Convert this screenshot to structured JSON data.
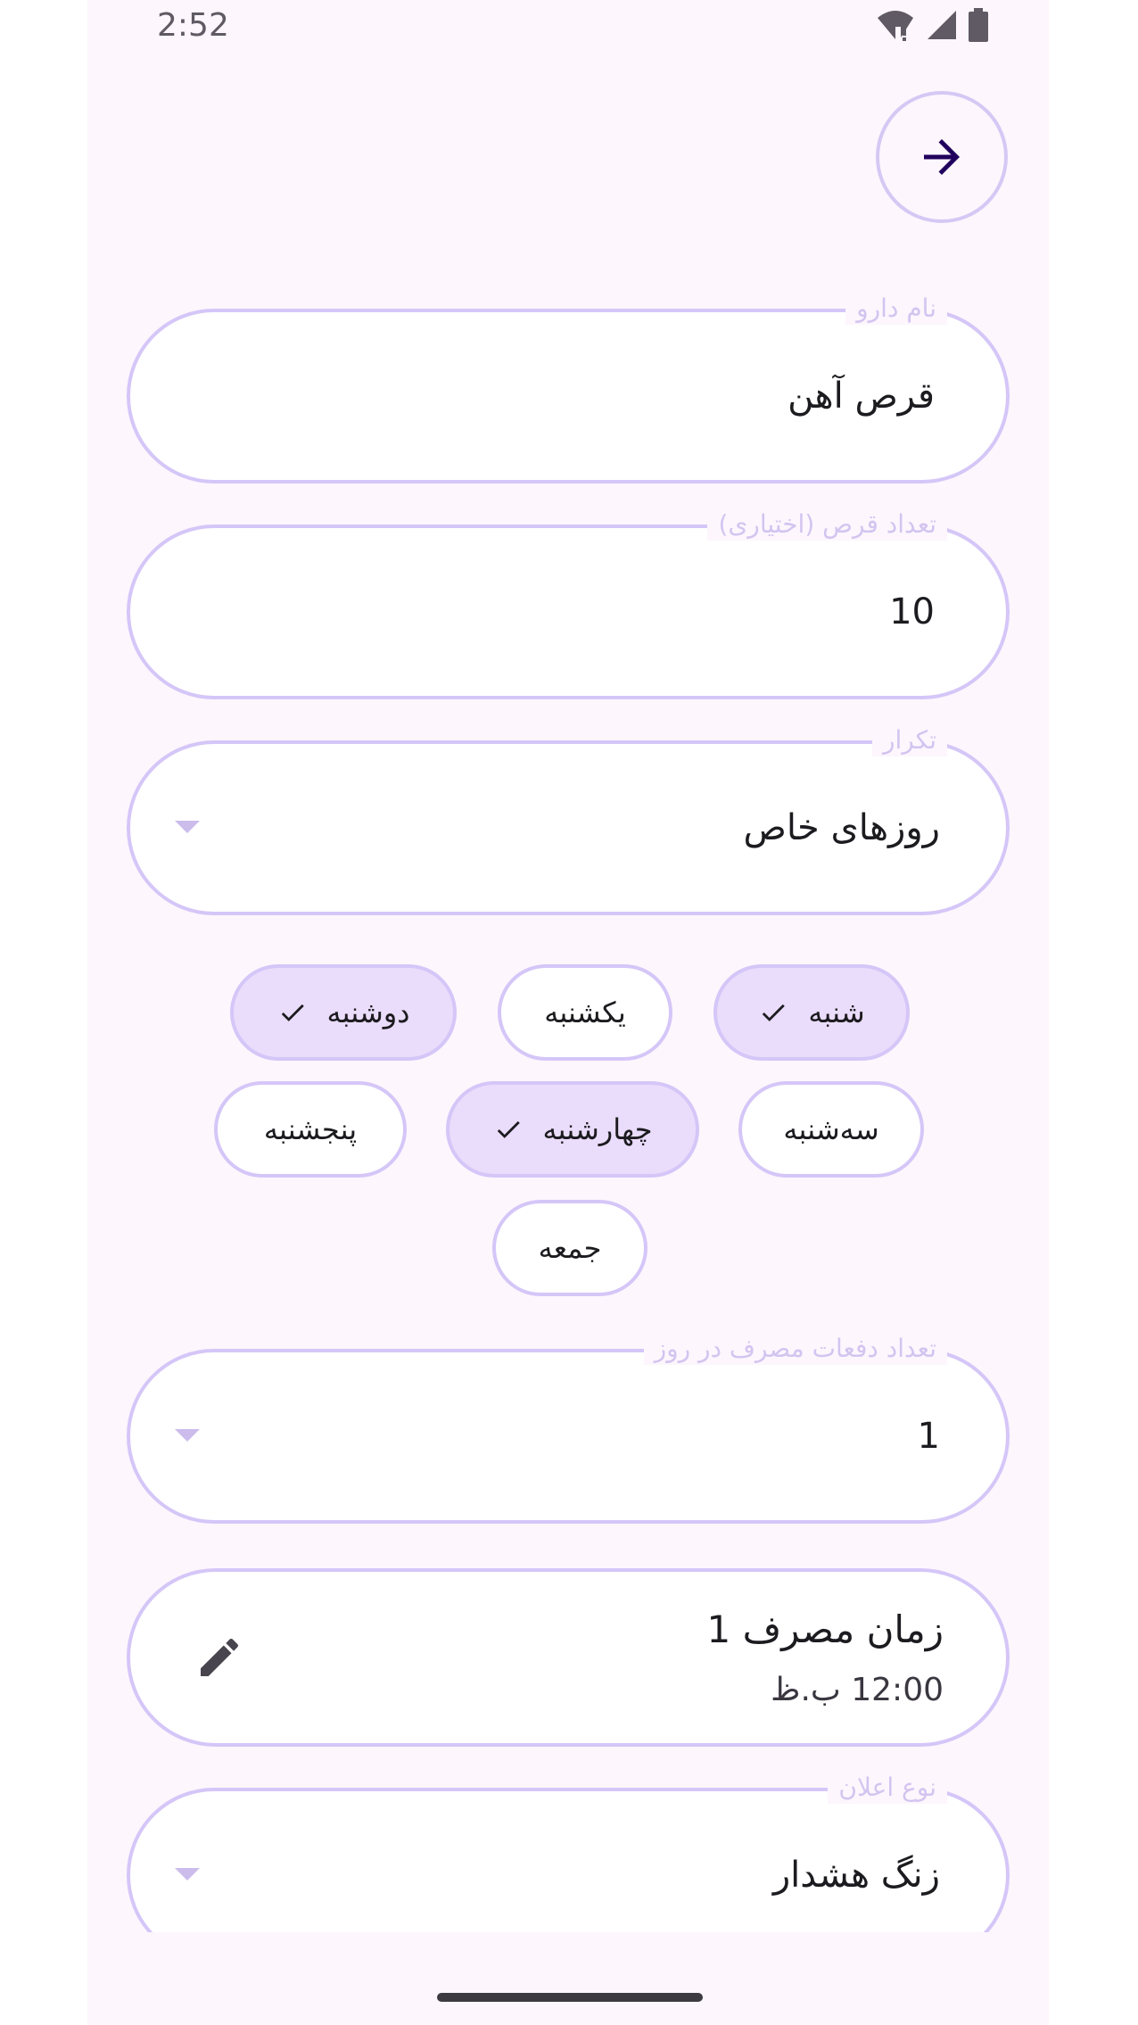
{
  "status_bar": {
    "time": "2:52"
  },
  "form": {
    "medicine_name": {
      "label": "نام دارو",
      "value": "قرص آهن"
    },
    "pill_count": {
      "label": "تعداد قرص (اختیاری)",
      "value": "10"
    },
    "repeat": {
      "label": "تکرار",
      "value": "روزهای خاص"
    },
    "days": [
      {
        "label": "شنبه",
        "selected": true
      },
      {
        "label": "یکشنبه",
        "selected": false
      },
      {
        "label": "دوشنبه",
        "selected": true
      },
      {
        "label": "سه‌شنبه",
        "selected": false
      },
      {
        "label": "چهارشنبه",
        "selected": true
      },
      {
        "label": "پنجشنبه",
        "selected": false
      },
      {
        "label": "جمعه",
        "selected": false
      }
    ],
    "times_per_day": {
      "label": "تعداد دفعات مصرف در روز",
      "value": "1"
    },
    "dose_time": {
      "title": "زمان مصرف 1",
      "time": "12:00 ب.ظ"
    },
    "notification_type": {
      "label": "نوع اعلان",
      "value": "زنگ هشدار"
    }
  },
  "icons": {
    "back": "arrow-right-icon",
    "check": "check-icon",
    "edit": "pencil-icon",
    "dropdown": "dropdown-arrow-icon"
  },
  "colors": {
    "background": "#fdf6fd",
    "outline": "#d5c6f8",
    "chip_selected": "#eadcfb",
    "label": "#d3c4f0",
    "text": "#1c1b1f"
  }
}
